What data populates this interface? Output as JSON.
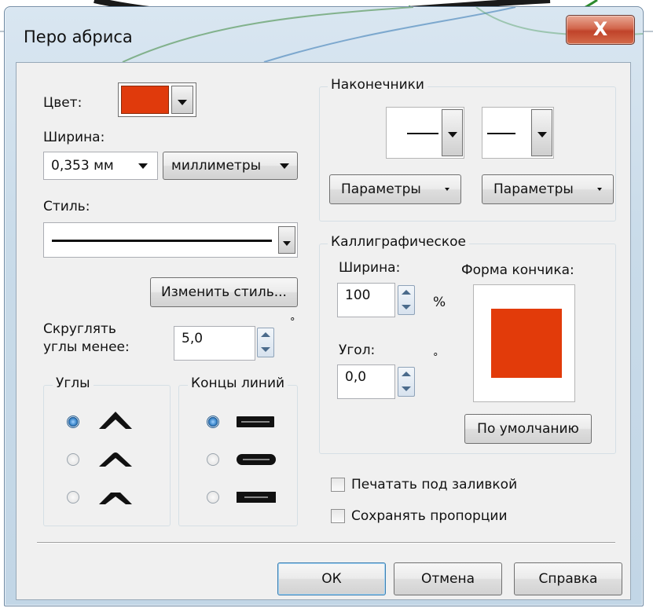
{
  "window": {
    "title": "Перо абриса",
    "close_glyph": "X"
  },
  "colors": {
    "swatch": "#e03a0c",
    "nib": "#e23b0a",
    "title_gradient": "#c9dbe9",
    "close_button": "#c7472b"
  },
  "left": {
    "color_label": "Цвет:",
    "width_label": "Ширина:",
    "width_value": "0,353 мм",
    "units_value": "миллиметры",
    "style_label": "Стиль:",
    "edit_style_button": "Изменить стиль...",
    "round_corners_label_1": "Скруглять",
    "round_corners_label_2": "углы менее:",
    "round_corners_value": "5,0",
    "round_corners_unit": "°"
  },
  "corners": {
    "title": "Углы",
    "selected_index": 0,
    "icons": [
      "miter-corner-icon",
      "round-corner-icon",
      "bevel-corner-icon"
    ]
  },
  "line_caps": {
    "title": "Концы линий",
    "selected_index": 0,
    "icons": [
      "butt-cap-icon",
      "round-cap-icon",
      "square-cap-icon"
    ]
  },
  "arrowheads": {
    "title": "Наконечники",
    "params_left": "Параметры",
    "params_right": "Параметры"
  },
  "calligraphic": {
    "title": "Каллиграфическое",
    "width_label": "Ширина:",
    "width_value": "100",
    "width_unit": "%",
    "angle_label": "Угол:",
    "angle_value": "0,0",
    "angle_unit": "°",
    "nib_shape_label": "Форма кончика:",
    "default_button": "По умолчанию"
  },
  "options": {
    "print_behind_fill": "Печатать под заливкой",
    "print_behind_fill_checked": false,
    "scale_with_image": "Сохранять пропорции",
    "scale_with_image_checked": false
  },
  "buttons": {
    "ok": "ОК",
    "cancel": "Отмена",
    "help": "Справка"
  }
}
